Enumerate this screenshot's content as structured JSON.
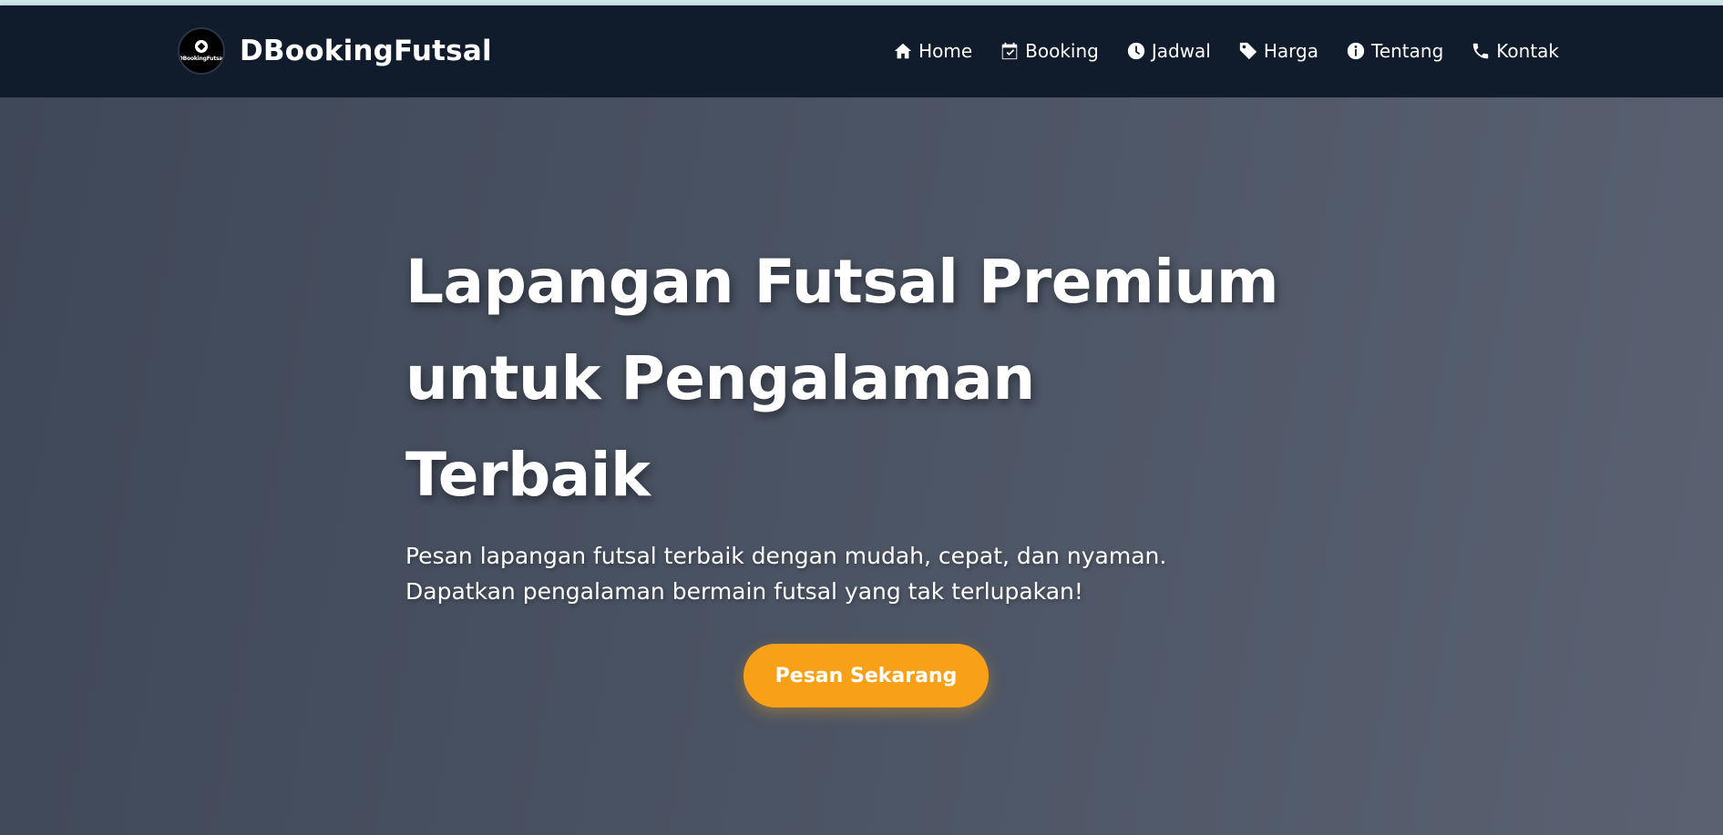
{
  "brand": {
    "logo_text": "DBookingFutsal",
    "name": "DBookingFutsal"
  },
  "nav": {
    "items": [
      {
        "label": "Home",
        "icon": "home-icon"
      },
      {
        "label": "Booking",
        "icon": "calendar-check-icon"
      },
      {
        "label": "Jadwal",
        "icon": "clock-icon"
      },
      {
        "label": "Harga",
        "icon": "tag-icon"
      },
      {
        "label": "Tentang",
        "icon": "info-circle-icon"
      },
      {
        "label": "Kontak",
        "icon": "phone-icon"
      }
    ]
  },
  "hero": {
    "title_line1": "Lapangan Futsal Premium",
    "title_line2": "untuk Pengalaman",
    "title_line3": "Terbaik",
    "subtitle_line1": "Pesan lapangan futsal terbaik dengan mudah, cepat, dan nyaman.",
    "subtitle_line2": "Dapatkan pengalaman bermain futsal yang tak terlupakan!",
    "cta_label": "Pesan Sekarang"
  },
  "colors": {
    "navbar_bg": "#101b2b",
    "hero_bg": "#4a5363",
    "accent": "#f8a118",
    "text": "#ffffff"
  }
}
